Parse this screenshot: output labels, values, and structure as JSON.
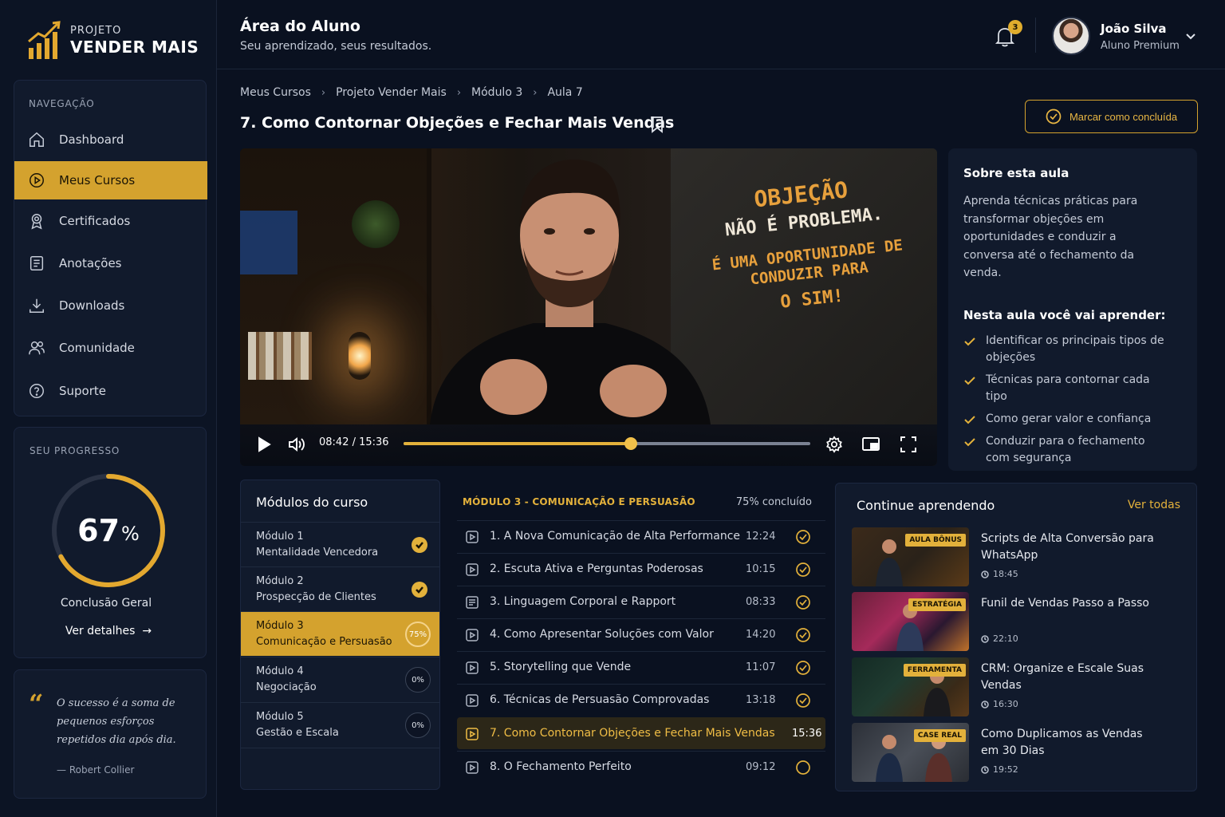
{
  "brand": {
    "line1": "PROJETO",
    "line2": "VENDER MAIS",
    "accent": "#d4a22e"
  },
  "header": {
    "title": "Área do Aluno",
    "subtitle": "Seu aprendizado, seus resultados.",
    "notifications": "3",
    "user_name": "João Silva",
    "user_role": "Aluno Premium"
  },
  "sidebar": {
    "nav_label": "NAVEGAÇÃO",
    "items": [
      {
        "label": "Dashboard",
        "icon": "home-icon"
      },
      {
        "label": "Meus Cursos",
        "icon": "play-circle-icon",
        "active": true
      },
      {
        "label": "Certificados",
        "icon": "award-icon"
      },
      {
        "label": "Anotações",
        "icon": "notes-icon"
      },
      {
        "label": "Downloads",
        "icon": "download-icon"
      },
      {
        "label": "Comunidade",
        "icon": "users-icon"
      },
      {
        "label": "Suporte",
        "icon": "help-icon"
      }
    ],
    "progress": {
      "label": "SEU PROGRESSO",
      "value": "67",
      "fraction": 0.67,
      "unit": "%",
      "caption": "Conclusão Geral",
      "link": "Ver detalhes"
    },
    "quote": {
      "text": "O sucesso é a soma de pequenos esforços repetidos dia após dia.",
      "author": "— Robert Collier"
    }
  },
  "breadcrumb": [
    "Meus Cursos",
    "Projeto Vender Mais",
    "Módulo 3",
    "Aula 7"
  ],
  "lesson": {
    "title": "7. Como Contornar Objeções e Fechar Mais Vendas",
    "mark_complete": "Marcar como concluída"
  },
  "video": {
    "time": "08:42 / 15:36",
    "progress": 0.558,
    "board": [
      "OBJEÇÃO",
      "NÃO É PROBLEMA.",
      "É UMA OPORTUNIDADE DE CONDUZIR PARA",
      "O SIM!"
    ]
  },
  "about": {
    "title": "Sobre esta aula",
    "description": "Aprenda técnicas práticas para transformar objeções em oportunidades e conduzir a conversa até o fechamento da venda.",
    "learn_title": "Nesta aula você vai aprender:",
    "learn": [
      "Identificar os principais tipos de objeções",
      "Técnicas para contornar cada tipo",
      "Como gerar valor e confiança",
      "Conduzir para o fechamento com segurança"
    ]
  },
  "modules": {
    "title": "Módulos do curso",
    "items": [
      {
        "line1": "Módulo 1",
        "line2": "Mentalidade Vencedora",
        "status": "done"
      },
      {
        "line1": "Módulo 2",
        "line2": "Prospecção de Clientes",
        "status": "done"
      },
      {
        "line1": "Módulo 3",
        "line2": "Comunicação e Persuasão",
        "status": "75%",
        "fraction": 0.75,
        "active": true
      },
      {
        "line1": "Módulo 4",
        "line2": "Negociação",
        "status": "0%"
      },
      {
        "line1": "Módulo 5",
        "line2": "Gestão e Escala",
        "status": "0%"
      }
    ]
  },
  "lessons": {
    "header": "MÓDULO 3 - COMUNICAÇÃO E PERSUASÃO",
    "completion": "75% concluído",
    "items": [
      {
        "title": "1. A Nova Comunicação de Alta Performance",
        "duration": "12:24",
        "done": true,
        "icon": "play-square-icon"
      },
      {
        "title": "2. Escuta Ativa e Perguntas Poderosas",
        "duration": "10:15",
        "done": true,
        "icon": "play-square-icon"
      },
      {
        "title": "3. Linguagem Corporal e Rapport",
        "duration": "08:33",
        "done": true,
        "icon": "document-icon"
      },
      {
        "title": "4. Como Apresentar Soluções com Valor",
        "duration": "14:20",
        "done": true,
        "icon": "play-square-icon"
      },
      {
        "title": "5. Storytelling que Vende",
        "duration": "11:07",
        "done": true,
        "icon": "play-square-icon"
      },
      {
        "title": "6. Técnicas de Persuasão Comprovadas",
        "duration": "13:18",
        "done": true,
        "icon": "play-square-icon"
      },
      {
        "title": "7. Como Contornar Objeções e Fechar Mais Vendas",
        "duration": "15:36",
        "current": true,
        "icon": "play-square-icon"
      },
      {
        "title": "8. O Fechamento Perfeito",
        "duration": "09:12",
        "done": false,
        "icon": "play-square-icon"
      }
    ]
  },
  "continue": {
    "title": "Continue aprendendo",
    "see_all": "Ver todas",
    "items": [
      {
        "tag": "AULA BÔNUS",
        "title": "Scripts de Alta Conversão para WhatsApp",
        "duration": "18:45"
      },
      {
        "tag": "ESTRATÉGIA",
        "title": "Funil de Vendas Passo a Passo",
        "duration": "22:10"
      },
      {
        "tag": "FERRAMENTA",
        "title": "CRM: Organize e Escale Suas Vendas",
        "duration": "16:30"
      },
      {
        "tag": "CASE REAL",
        "title": "Como Duplicamos as Vendas em 30 Dias",
        "duration": "19:52"
      }
    ]
  }
}
